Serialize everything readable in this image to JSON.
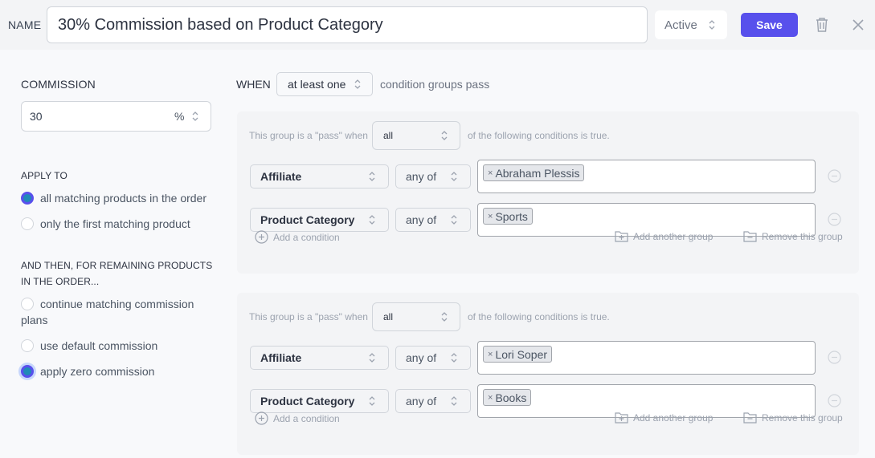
{
  "header": {
    "name_label": "NAME",
    "name_value": "30% Commission based on Product Category",
    "status": "Active",
    "save_label": "Save",
    "icons": [
      "chevron-updown-icon",
      "trash-icon",
      "close-icon"
    ]
  },
  "commission": {
    "label": "COMMISSION",
    "value": "30",
    "unit": "%"
  },
  "apply_to": {
    "label": "APPLY TO",
    "options": [
      {
        "label": "all matching products in the order",
        "selected": true
      },
      {
        "label": "only the first matching product",
        "selected": false
      }
    ]
  },
  "remaining": {
    "label_line1": "AND THEN, FOR REMAINING PRODUCTS",
    "label_line2": "IN THE ORDER...",
    "options": [
      {
        "label_line1": "continue matching commission",
        "label_line2": "plans",
        "selected": false
      },
      {
        "label": "use default commission",
        "selected": false
      },
      {
        "label": "apply zero commission",
        "selected": true
      }
    ]
  },
  "when": {
    "label": "WHEN",
    "selector": "at least one",
    "tail": "condition groups pass"
  },
  "groups": [
    {
      "pass_text": "This group is a \"pass\" when",
      "pass_select": "all",
      "pass_tail": "of the following conditions is true.",
      "conditions": [
        {
          "field": "Affiliate",
          "operator": "any of",
          "tags": [
            "Abraham Plessis"
          ]
        },
        {
          "field": "Product Category",
          "operator": "any of",
          "tags": [
            "Sports"
          ]
        }
      ],
      "add_condition": "Add a condition",
      "add_group": "Add another group",
      "remove_group": "Remove this group"
    },
    {
      "pass_text": "This group is a \"pass\" when",
      "pass_select": "all",
      "pass_tail": "of the following conditions is true.",
      "conditions": [
        {
          "field": "Affiliate",
          "operator": "any of",
          "tags": [
            "Lori Soper"
          ]
        },
        {
          "field": "Product Category",
          "operator": "any of",
          "tags": [
            "Books"
          ]
        }
      ],
      "add_condition": "Add a condition",
      "add_group": "Add another group",
      "remove_group": "Remove this group"
    }
  ],
  "tag_remove_glyph": "×",
  "colors": {
    "accent": "#5850ec",
    "radio_fill": "#1f8ab8",
    "header_bg": "#f3f4f6",
    "group_bg": "#f3f4f6"
  }
}
